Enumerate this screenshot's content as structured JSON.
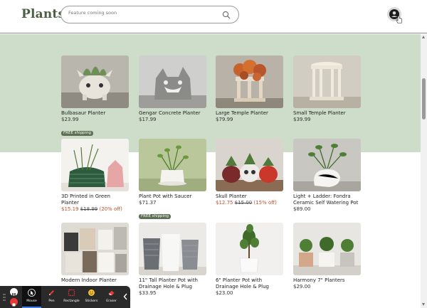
{
  "header": {
    "logo": "Plantsy",
    "search_placeholder": "Feature coming soon"
  },
  "products": [
    {
      "name": "Bulbasaur Planter",
      "price": "$23.99",
      "badge": "FREE shipping"
    },
    {
      "name": "Gengar Concrete Planter",
      "price": "$17.99"
    },
    {
      "name": "Large Temple Planter",
      "price": "$79.99"
    },
    {
      "name": "Small Temple Planter",
      "price": "$39.99"
    },
    {
      "name": "3D Printed in Green Planter",
      "sale_price": "$15.19",
      "original_price": "$18.99",
      "discount": "(20% off)"
    },
    {
      "name": "Plant Pot with Saucer",
      "price": "$71.37",
      "badge": "FREE shipping"
    },
    {
      "name": "Skull Planter",
      "sale_price": "$12.75",
      "original_price": "$15.00",
      "discount": "(15% off)"
    },
    {
      "name": "Light + Ladder: Fondra Ceramic Self Watering Pot",
      "price": "$89.00"
    },
    {
      "name": "Modern Indoor Planter",
      "price": ""
    },
    {
      "name": "11\" Tall Planter Pot with Drainage Hole & Plug",
      "price": "$33.95"
    },
    {
      "name": "6\" Planter Pot with Drainage Hole & Plug",
      "price": "$23.00"
    },
    {
      "name": "Harmony 7\" Planters",
      "price": "$29.00"
    }
  ],
  "toolbar": {
    "items": [
      {
        "label": "Mouse",
        "icon": "cursor-icon"
      },
      {
        "label": "Pen",
        "icon": "pen-icon"
      },
      {
        "label": "Rectangle",
        "icon": "rectangle-icon"
      },
      {
        "label": "Stickers",
        "icon": "sticker-icon"
      },
      {
        "label": "Eraser",
        "icon": "eraser-icon"
      }
    ]
  },
  "colors": {
    "brand": "#4e6044",
    "band": "#cdddc9",
    "sale": "#c0502b",
    "badge": "#5d7053"
  }
}
